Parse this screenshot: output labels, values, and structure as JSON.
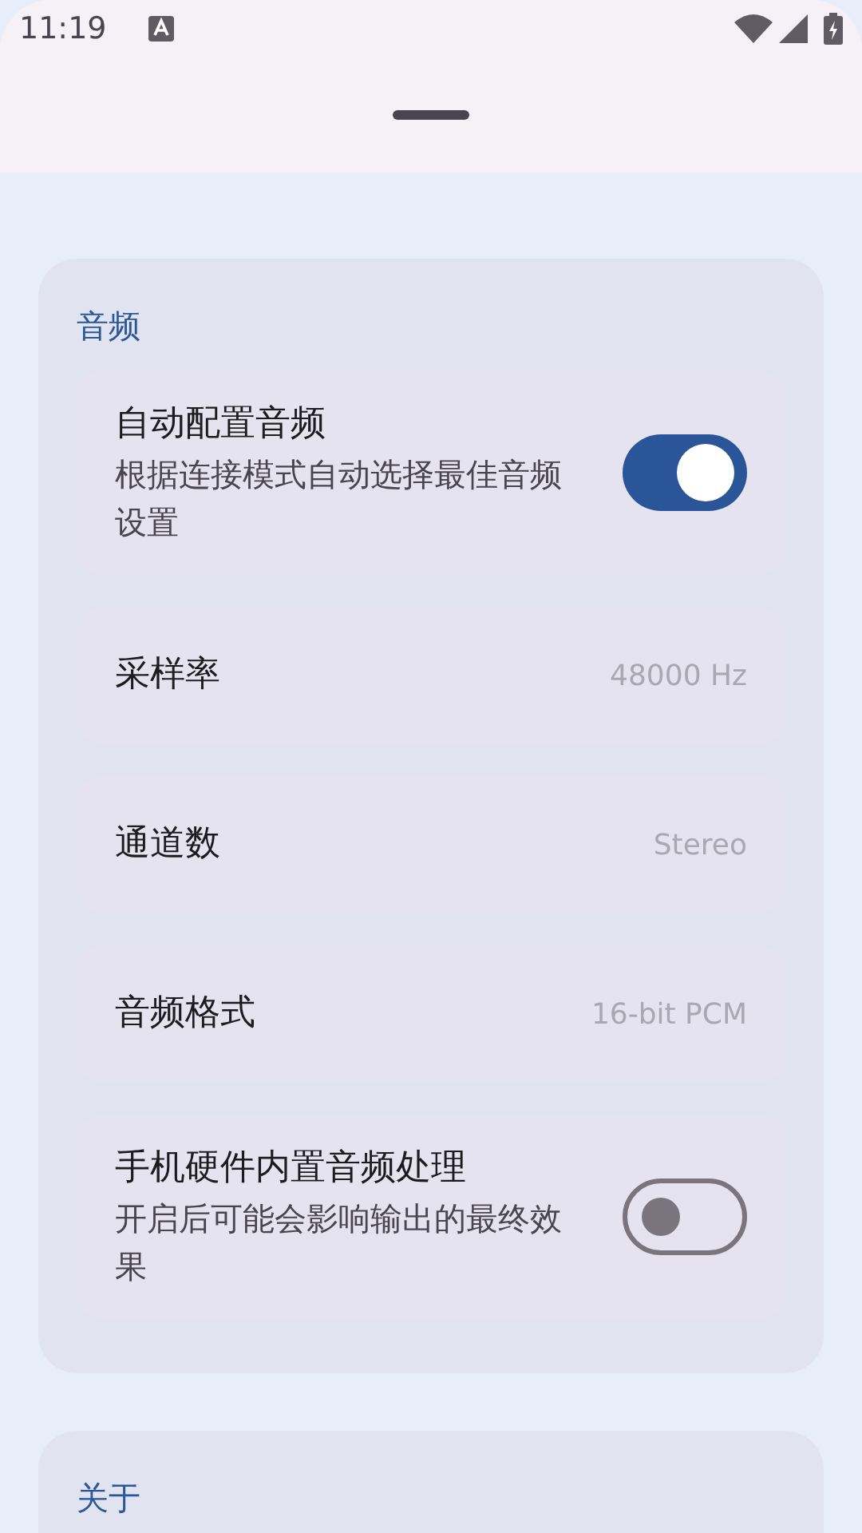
{
  "status_bar": {
    "time": "11:19"
  },
  "sections": [
    {
      "title": "音频",
      "items": [
        {
          "kind": "toggle",
          "title": "自动配置音频",
          "subtitle": "根据连接模式自动选择最佳音频设置",
          "on": true
        },
        {
          "kind": "value",
          "title": "采样率",
          "value": "48000 Hz"
        },
        {
          "kind": "value",
          "title": "通道数",
          "value": "Stereo"
        },
        {
          "kind": "value",
          "title": "音频格式",
          "value": "16-bit PCM"
        },
        {
          "kind": "toggle",
          "title": "手机硬件内置音频处理",
          "subtitle": "开启后可能会影响输出的最终效果",
          "on": false
        }
      ]
    },
    {
      "title": "关于"
    }
  ]
}
